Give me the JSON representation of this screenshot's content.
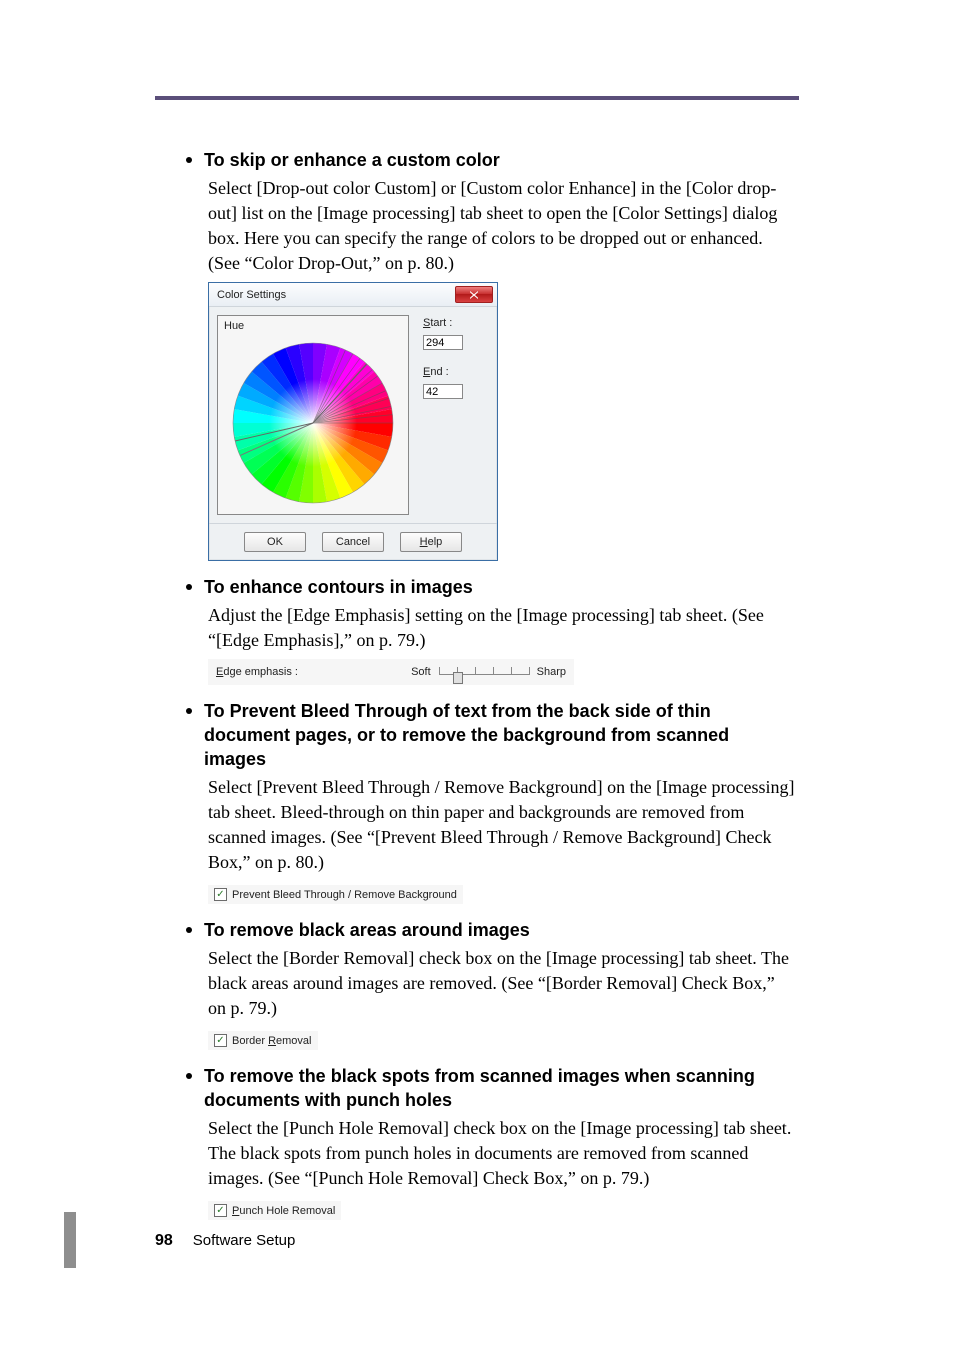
{
  "sections": {
    "skip_enhance": {
      "title": "To skip or enhance a custom color",
      "body": "Select [Drop-out color Custom] or [Custom color Enhance] in the [Color drop-out] list on the [Image processing] tab sheet to open the [Color Settings] dialog box. Here you can specify the range of colors to be dropped out or enhanced. (See “Color Drop-Out,” on p. 80.)"
    },
    "contours": {
      "title": "To enhance contours in images",
      "body": "Adjust the [Edge Emphasis] setting on the [Image processing] tab sheet. (See “[Edge Emphasis],” on p. 79.)"
    },
    "bleed": {
      "title": "To Prevent Bleed Through of text from the back side of thin document pages, or to remove the background from scanned images",
      "body": "Select [Prevent Bleed Through / Remove Background] on the [Image processing] tab sheet. Bleed-through on thin paper and backgrounds are removed from scanned images. (See “[Prevent Bleed Through / Remove Background] Check Box,” on p. 80.)"
    },
    "border": {
      "title": "To remove black areas around images",
      "body": "Select the [Border Removal] check box on the [Image processing] tab sheet. The black areas around images are removed. (See “[Border Removal] Check Box,” on p. 79.)"
    },
    "punch": {
      "title": "To remove the black spots from scanned images when scanning documents with punch holes",
      "body": "Select the [Punch Hole Removal] check box on the [Image processing] tab sheet. The black spots from punch holes in documents are removed from scanned images. (See “[Punch Hole Removal] Check Box,” on p. 79.)"
    }
  },
  "dialog": {
    "title": "Color Settings",
    "hue_label": "Hue",
    "start_label": "Start :",
    "start_value": "294",
    "end_label": "End :",
    "end_value": "42",
    "ok": "OK",
    "cancel": "Cancel",
    "help": "Help"
  },
  "edge_emphasis": {
    "label": "Edge emphasis :",
    "soft": "Soft",
    "sharp": "Sharp"
  },
  "checkboxes": {
    "bleed": "Prevent Bleed Through / Remove Background",
    "border_pre": "Border ",
    "border_u": "R",
    "border_post": "emoval",
    "punch_pre": "",
    "punch_u": "P",
    "punch_post": "unch Hole Removal"
  },
  "footer": {
    "page": "98",
    "section": "Software Setup"
  }
}
